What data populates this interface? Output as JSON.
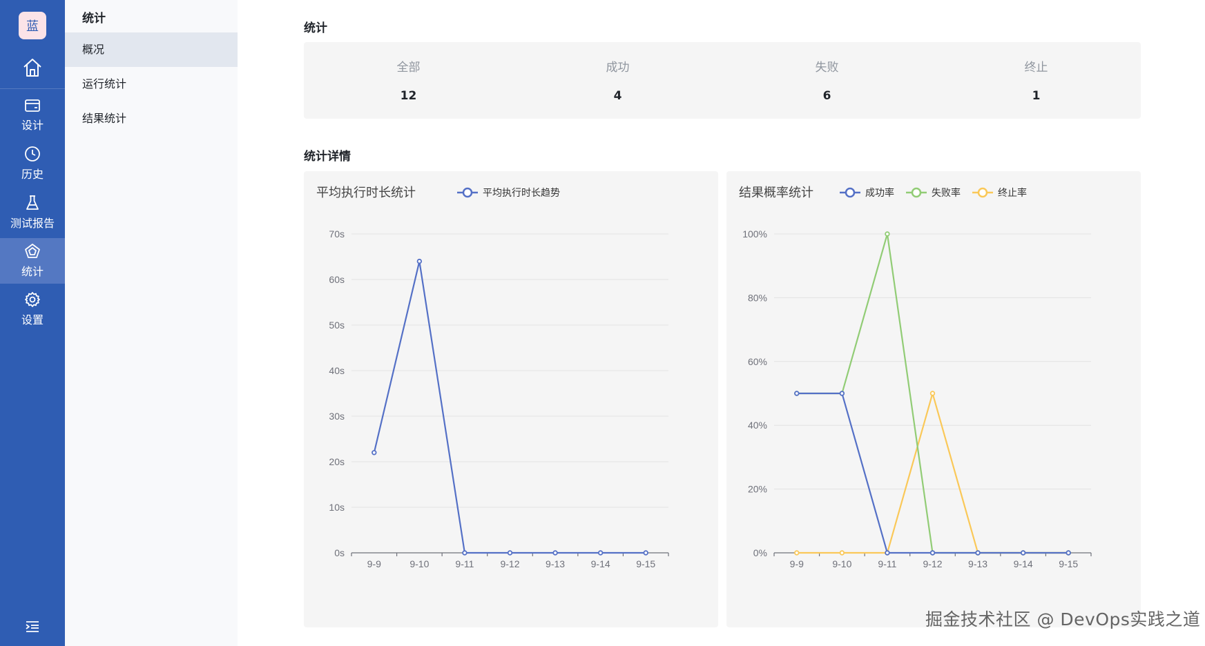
{
  "sidebar": {
    "logo_text": "蓝",
    "items": [
      {
        "label": "设计",
        "icon": "card-icon"
      },
      {
        "label": "历史",
        "icon": "clock-icon"
      },
      {
        "label": "测试报告",
        "icon": "flask-icon"
      },
      {
        "label": "统计",
        "icon": "pentagon-icon"
      },
      {
        "label": "设置",
        "icon": "gear-icon"
      }
    ],
    "active_index": 3
  },
  "subnav": {
    "title": "统计",
    "items": [
      "概况",
      "运行统计",
      "结果统计"
    ],
    "active_index": 0
  },
  "main": {
    "summary_title": "统计",
    "summary": [
      {
        "label": "全部",
        "value": "12"
      },
      {
        "label": "成功",
        "value": "4"
      },
      {
        "label": "失败",
        "value": "6"
      },
      {
        "label": "终止",
        "value": "1"
      }
    ],
    "details_title": "统计详情"
  },
  "colors": {
    "rail": "#2f5db3",
    "blue": "#5470c6",
    "green": "#91cc75",
    "yellow": "#fac858"
  },
  "watermark": "掘金技术社区 @ DevOps实践之道",
  "chart_data": [
    {
      "type": "line",
      "title": "平均执行时长统计",
      "categories": [
        "9-9",
        "9-10",
        "9-11",
        "9-12",
        "9-13",
        "9-14",
        "9-15"
      ],
      "series": [
        {
          "name": "平均执行时长趋势",
          "values": [
            22,
            64,
            0,
            0,
            0,
            0,
            0
          ],
          "color": "#5470c6"
        }
      ],
      "yticks": [
        "0s",
        "10s",
        "20s",
        "30s",
        "40s",
        "50s",
        "60s",
        "70s"
      ],
      "ylim": [
        0,
        70
      ],
      "grid": true,
      "legend": "top"
    },
    {
      "type": "line",
      "title": "结果概率统计",
      "categories": [
        "9-9",
        "9-10",
        "9-11",
        "9-12",
        "9-13",
        "9-14",
        "9-15"
      ],
      "series": [
        {
          "name": "成功率",
          "values": [
            50,
            50,
            0,
            0,
            0,
            0,
            0
          ],
          "color": "#5470c6"
        },
        {
          "name": "失败率",
          "values": [
            50,
            50,
            100,
            0,
            0,
            0,
            0
          ],
          "color": "#91cc75"
        },
        {
          "name": "终止率",
          "values": [
            0,
            0,
            0,
            50,
            0,
            0,
            0
          ],
          "color": "#fac858"
        }
      ],
      "yticks": [
        "0%",
        "20%",
        "40%",
        "60%",
        "80%",
        "100%"
      ],
      "ylim": [
        0,
        100
      ],
      "grid": true,
      "legend": "top"
    }
  ]
}
